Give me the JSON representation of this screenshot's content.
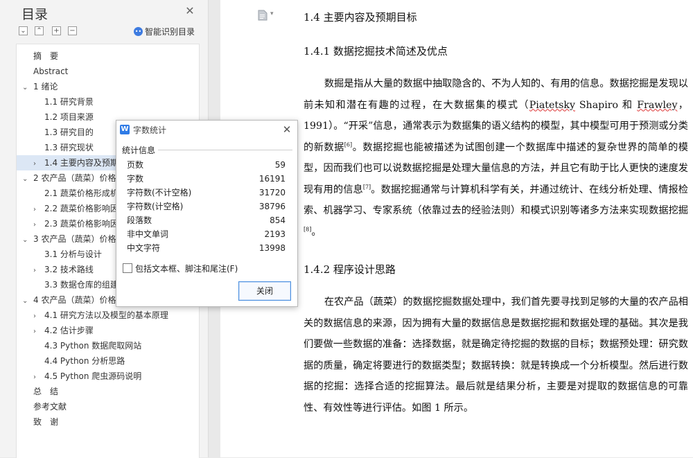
{
  "sidebar": {
    "title": "目录",
    "smart_toc_label": "智能识别目录",
    "items": [
      {
        "label": "摘　要",
        "level": 0,
        "chevron": ""
      },
      {
        "label": "Abstract",
        "level": 0,
        "chevron": ""
      },
      {
        "label": "1 绪论",
        "level": 0,
        "chevron": "v"
      },
      {
        "label": "1.1 研究背景",
        "level": 1,
        "chevron": ""
      },
      {
        "label": "1.2 项目来源",
        "level": 1,
        "chevron": ""
      },
      {
        "label": "1.3 研究目的",
        "level": 1,
        "chevron": ""
      },
      {
        "label": "1.3 研究现状",
        "level": 1,
        "chevron": ""
      },
      {
        "label": "1.4 主要内容及预期",
        "level": 1,
        "chevron": ">",
        "active": true
      },
      {
        "label": "2 农产品（蔬菜）价格",
        "level": 0,
        "chevron": "v"
      },
      {
        "label": "2.1 蔬菜价格形成机",
        "level": 1,
        "chevron": ""
      },
      {
        "label": "2.2 蔬菜价格影响因",
        "level": 1,
        "chevron": ">"
      },
      {
        "label": "2.3 蔬菜价格影响因",
        "level": 1,
        "chevron": ">"
      },
      {
        "label": "3 农产品（蔬菜）价格",
        "level": 0,
        "chevron": "v"
      },
      {
        "label": "3.1 分析与设计",
        "level": 1,
        "chevron": ""
      },
      {
        "label": "3.2 技术路线",
        "level": 1,
        "chevron": ">"
      },
      {
        "label": "3.3 数据仓库的组建",
        "level": 1,
        "chevron": ""
      },
      {
        "label": "4 农产品（蔬菜）价格",
        "level": 0,
        "chevron": "v"
      },
      {
        "label": "4.1  研究方法以及模型的基本原理",
        "level": 1,
        "chevron": ">"
      },
      {
        "label": "4.2  估计步骤",
        "level": 1,
        "chevron": ">"
      },
      {
        "label": "4.3 Python 数据爬取网站",
        "level": 1,
        "chevron": ""
      },
      {
        "label": "4.4 Python 分析思路",
        "level": 1,
        "chevron": ""
      },
      {
        "label": "4.5 Python 爬虫源码说明",
        "level": 1,
        "chevron": ">"
      },
      {
        "label": "总　结",
        "level": 0,
        "chevron": ""
      },
      {
        "label": "参考文献",
        "level": 0,
        "chevron": ""
      },
      {
        "label": "致　谢",
        "level": 0,
        "chevron": ""
      }
    ]
  },
  "document": {
    "heading_main": "1.4 主要内容及预期目标",
    "heading_sub1": "1.4.1 数据挖掘技术简述及优点",
    "para1_a": "数掘是指从大量的数据中抽取隐含的、不为人知的、有用的信息。数据挖掘是发现以前未知和潜在有趣的过程，在大数据集的模式（",
    "para1_name1": "Piatetsky",
    "para1_b": " Shapiro 和 ",
    "para1_name2": "Frawley",
    "para1_c": "，1991）。“开采”信息，通常表示为数据集的语义结构的模型，其中模型可用于预测或分类的新数据",
    "cite6": "[6]",
    "para1_d": "。数据挖掘也能被描述为试图创建一个数据库中描述的复杂世界的简单的模型，因而我们也可以说数据挖掘是处理大量信息的方法，并且它有助于比人更快的速度发现有用的信息",
    "cite7": "[7]",
    "para1_e": "。数据挖掘通常与计算机科学有关，并通过统计、在线分析处理、情报检索、机器学习、专家系统（依靠过去的经验法则）和模式识别等诸多方法来实现数据挖掘",
    "cite8": "[8]",
    "para1_f": "。",
    "heading_sub2": "1.4.2 程序设计思路",
    "para2": "在农产品（蔬菜）的数据挖掘数据处理中，我们首先要寻找到足够的大量的农产品相关的数据信息的来源，因为拥有大量的数据信息是数据挖掘和数据处理的基础。其次是我们要做一些数据的准备：选择数据，就是确定待挖掘的数据的目标；数据预处理：研究数据的质量，确定将要进行的数据类型；数据转换：就是转换成一个分析模型。然后进行数据的挖掘：选择合适的挖掘算法。最后就是结果分析，主要是对提取的数据信息的可靠性、有效性等进行评估。如图 1 所示。"
  },
  "dialog": {
    "title": "字数统计",
    "section_label": "统计信息",
    "stats": [
      {
        "label": "页数",
        "value": "59"
      },
      {
        "label": "字数",
        "value": "16191"
      },
      {
        "label": "字符数(不计空格)",
        "value": "31720"
      },
      {
        "label": "字符数(计空格)",
        "value": "38796"
      },
      {
        "label": "段落数",
        "value": "854"
      },
      {
        "label": "非中文单词",
        "value": "2193"
      },
      {
        "label": "中文字符",
        "value": "13998"
      }
    ],
    "checkbox_label": "包括文本框、脚注和尾注(F)",
    "checkbox_checked": false,
    "close_button_label": "关闭"
  },
  "icons": {
    "close": "close-icon",
    "collapse": "collapse-all-icon",
    "expand": "expand-all-icon",
    "add": "add-heading-icon",
    "remove": "remove-heading-icon",
    "smart": "smart-toc-icon",
    "page": "page-icon",
    "app": "wps-writer-icon"
  }
}
